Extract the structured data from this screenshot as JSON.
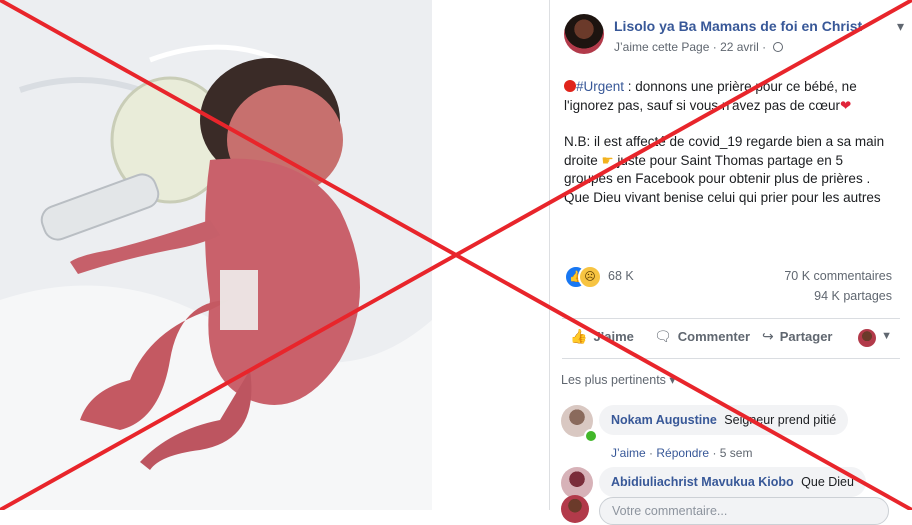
{
  "page": {
    "name": "Lisolo ya Ba Mamans de foi en Christ",
    "like_label": "J’aime cette Page",
    "date": "22 avril"
  },
  "post": {
    "urgent_tag": "#Urgent",
    "line1": " : donnons une prière pour ce bébé, ne l'ignorez pas, sauf si vous n'avez pas de cœur",
    "para2": "N.B: il est affecté de covid_19 regarde bien a sa main droite",
    "para2_rest": " juste pour Saint Thomas partage en 5 groupes en Facebook pour obtenir plus de prières . Que Dieu vivant benise celui qui prier pour les autres"
  },
  "stats": {
    "reactions": "68 K",
    "comments": "70 K commentaires",
    "shares": "94 K partages"
  },
  "actions": {
    "like": "J’aime",
    "comment": "Commenter",
    "share": "Partager"
  },
  "comments_filter": "Les plus pertinents",
  "comments": [
    {
      "author": "Nokam Augustine",
      "text": "Seigneur prend pitié",
      "like": "J’aime",
      "reply": "Répondre",
      "age": "5 sem"
    },
    {
      "author": "Abidiuliachrist Mavukua Kiobo",
      "text": "Que Dieu"
    }
  ],
  "composer": {
    "placeholder": "Votre commentaire..."
  },
  "colors": {
    "link_blue": "#385898",
    "cross_red": "#e8252b",
    "online_green": "#42b72a"
  },
  "icons": [
    "globe-icon",
    "like-reaction-icon",
    "sad-reaction-icon",
    "like-action-icon",
    "comment-action-icon",
    "share-action-icon",
    "chevron-down-icon"
  ]
}
